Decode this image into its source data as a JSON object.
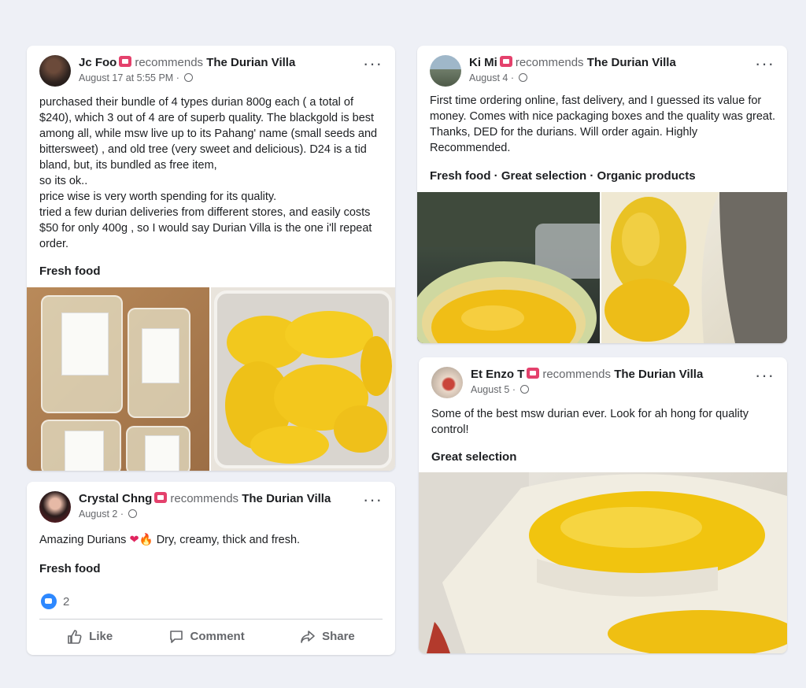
{
  "reviews": [
    {
      "author": "Jc Foo",
      "verb": "recommends",
      "page": "The Durian Villa",
      "date": "August 17 at 5:55 PM",
      "text": "purchased their bundle of 4 types durian 800g each ( a total of $240), which 3 out of 4 are of superb quality. The blackgold is best among all, while msw live up to its Pahang' name (small seeds and bittersweet) , and old tree (very sweet and delicious). D24 is a tid bland, but, its bundled as free item,\nso its ok..\nprice wise is very worth spending for its quality.\ntried a few durian deliveries from different stores, and easily costs $50 for only 400g  , so I would say Durian Villa is the one i'll repeat order.",
      "tags": "Fresh food"
    },
    {
      "author": "Ki Mi",
      "verb": "recommends",
      "page": "The Durian Villa",
      "date": "August 4",
      "text": "First time ordering online, fast delivery, and I guessed its value for money. Comes with nice packaging boxes and the quality was great. Thanks, DED for the durians. Will order again. Highly Recommended.",
      "tags": "Fresh food · Great selection · Organic products"
    },
    {
      "author": "Et Enzo T",
      "verb": "recommends",
      "page": "The Durian Villa",
      "date": "August 5",
      "text": "Some of the best msw durian ever. Look for ah hong for quality control!",
      "tags": "Great selection"
    },
    {
      "author": "Crystal Chng",
      "verb": "recommends",
      "page": "The Durian Villa",
      "date": "August 2",
      "text_before": "Amazing Durians",
      "text_after": "Dry, creamy, thick and fresh.",
      "tags": "Fresh food",
      "reaction_count": "2",
      "actions": {
        "like": "Like",
        "comment": "Comment",
        "share": "Share"
      }
    }
  ],
  "icons": {
    "more": "more-options-icon",
    "globe": "public-globe-icon",
    "badge": "recommendation-badge-icon",
    "like": "like-thumb-icon",
    "comment": "comment-bubble-icon",
    "share": "share-arrow-icon"
  },
  "colors": {
    "background": "#eef0f6",
    "badge": "#e4416c",
    "like": "#2d88ff",
    "durian_flesh": "#f2c81e"
  }
}
